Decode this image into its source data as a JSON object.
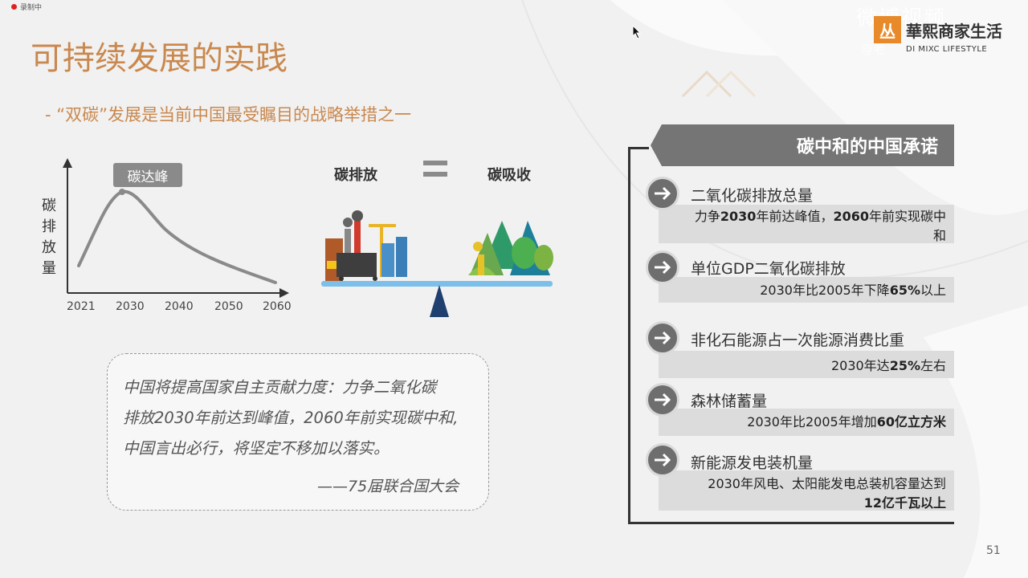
{
  "recording": {
    "label": "录制中"
  },
  "watermark": {
    "site": "微博视频",
    "handle": "@老"
  },
  "brand": {
    "logo_char": "丛",
    "name": "華熙商家生活",
    "sub": "DI MIXC LIFESTYLE"
  },
  "slide": {
    "title": "可持续发展的实践",
    "subtitle": "- “双碳”发展是当前中国最受瞩目的战略举措之一",
    "page": "51"
  },
  "peak_chart": {
    "peak_label": "碳达峰",
    "ylabel": "碳排放量",
    "ticks": [
      "2021",
      "2030",
      "2040",
      "2050",
      "2060"
    ]
  },
  "balance": {
    "left": "碳排放",
    "right": "碳吸收"
  },
  "quote": {
    "lines": [
      "中国将提高国家自主贡献力度：力争二氧化碳",
      "排放2030年前达到峰值，2060年前实现碳中和,",
      "中国言出必行，将坚定不移加以落实。"
    ],
    "source": "——75届联合国大会"
  },
  "commitments": {
    "header": "碳中和的中国承诺",
    "items": [
      {
        "title": "二氧化碳排放总量",
        "desc": [
          "力争",
          "2030",
          "年前达峰值，",
          "2060",
          "年前实现碳中",
          "和"
        ]
      },
      {
        "title": "单位GDP二氧化碳排放",
        "desc": [
          "2030年比2005年下降",
          "65%",
          "以上"
        ]
      },
      {
        "title": "非化石能源占一次能源消费比重",
        "desc": [
          "2030年达",
          "25%",
          "左右"
        ]
      },
      {
        "title": "森林储蓄量",
        "desc": [
          "2030年比2005年增加",
          "60亿立方米"
        ]
      },
      {
        "title": "新能源发电装机量",
        "desc": [
          "2030年风电、太阳能发电总装机容量达到",
          "12亿千瓦以上"
        ]
      }
    ]
  }
}
